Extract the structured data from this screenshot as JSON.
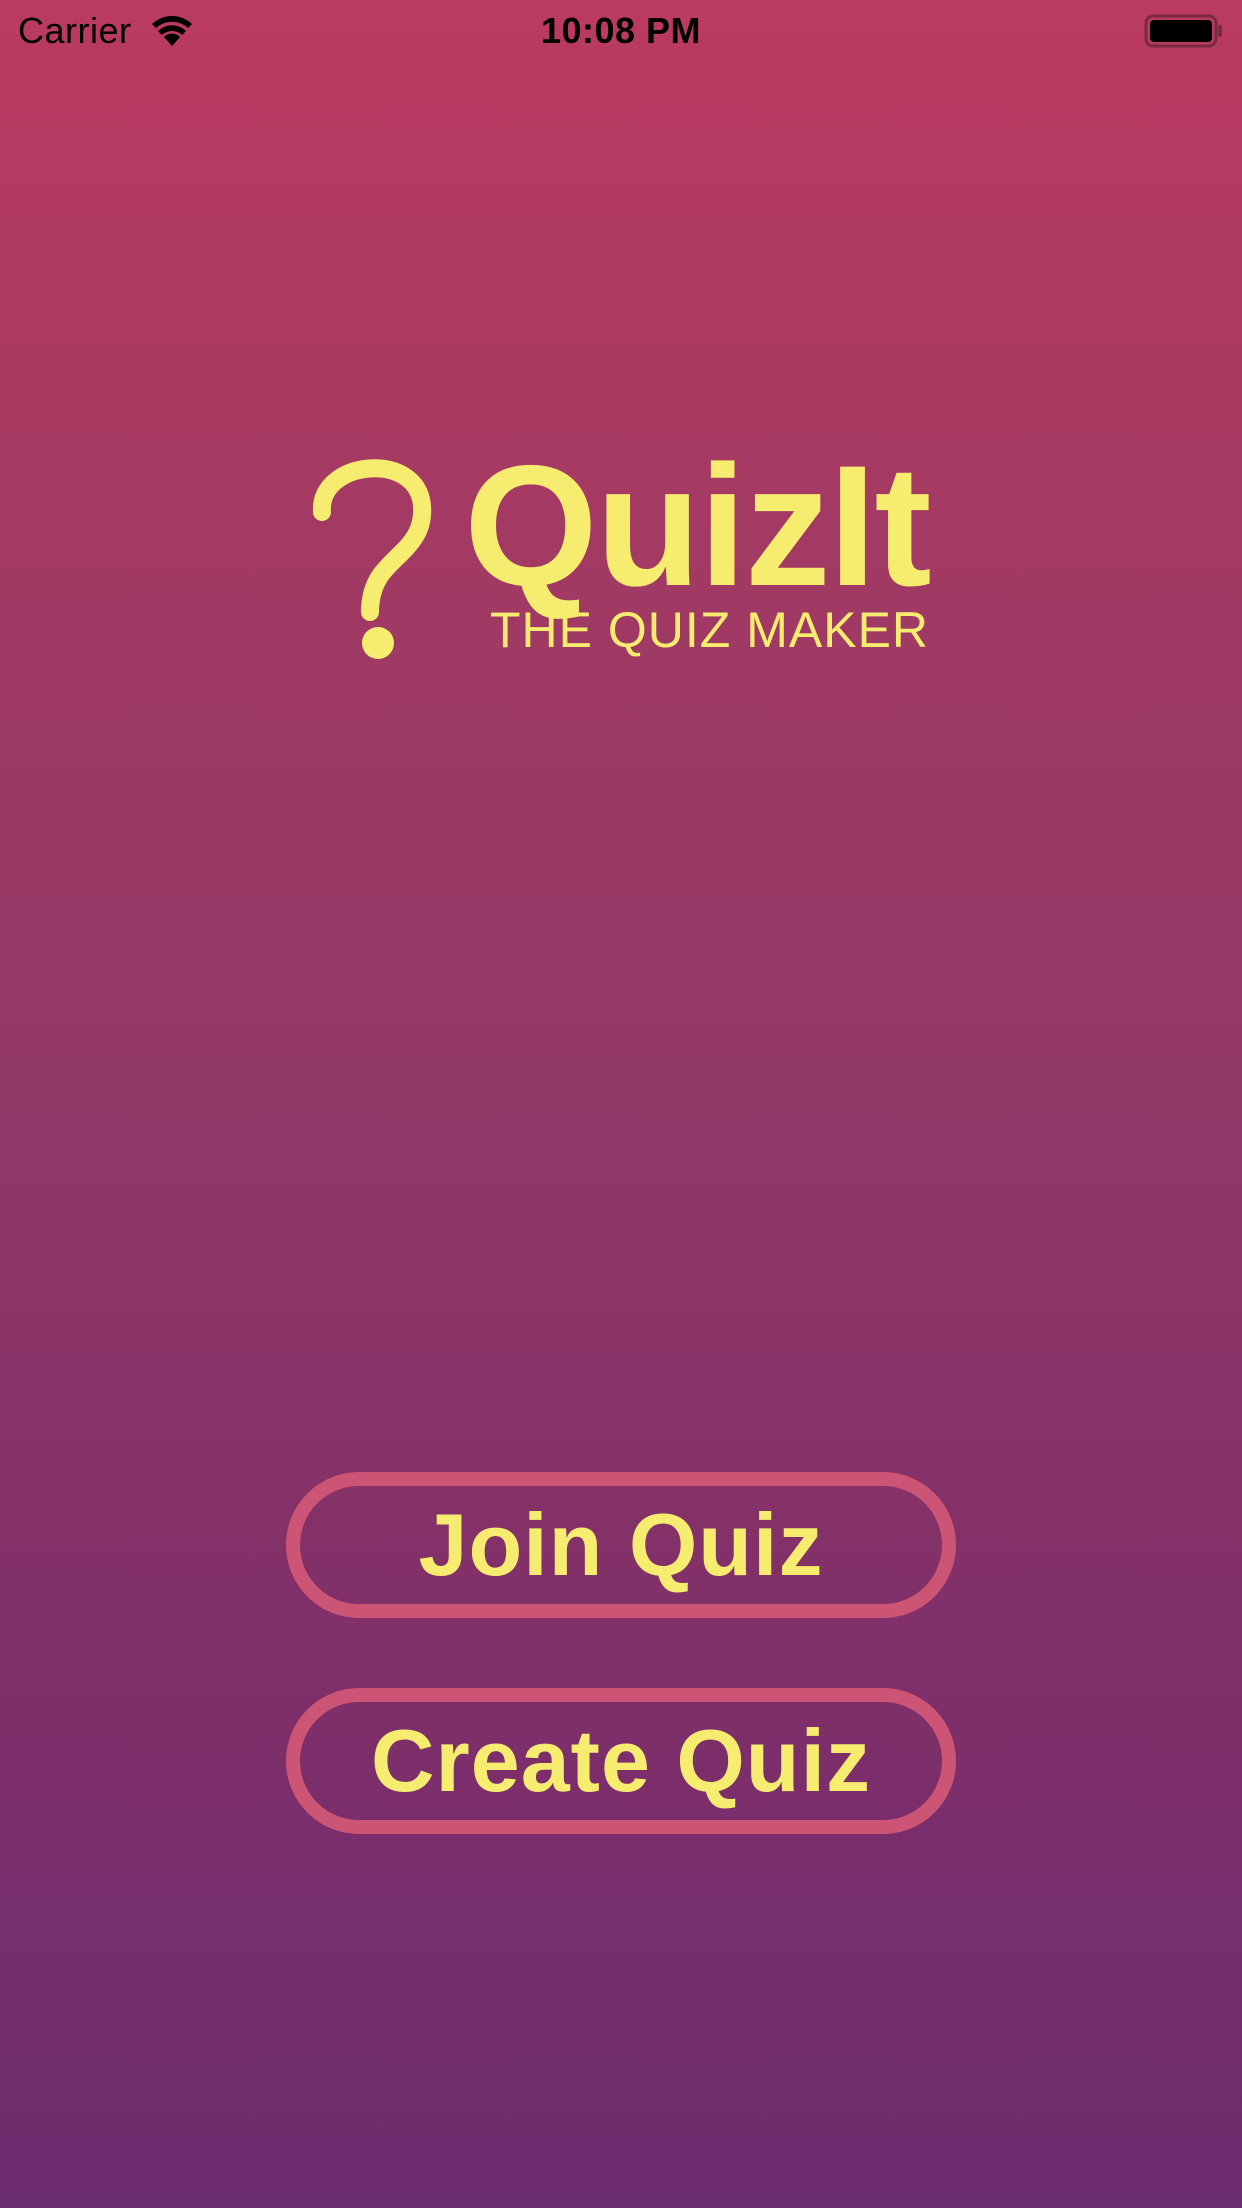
{
  "status_bar": {
    "carrier": "Carrier",
    "time": "10:08 PM",
    "icons": [
      "wifi-icon",
      "battery-icon"
    ]
  },
  "logo": {
    "title": "QuizIt",
    "subtitle": "THE QUIZ MAKER",
    "icon": "question-mark-icon"
  },
  "actions": {
    "join_label": "Join Quiz",
    "create_label": "Create Quiz"
  },
  "colors": {
    "accent_text": "#f6ec70",
    "button_border": "#cc5474",
    "background_top": "#bb3a60",
    "background_bottom": "#6c2d6f"
  }
}
